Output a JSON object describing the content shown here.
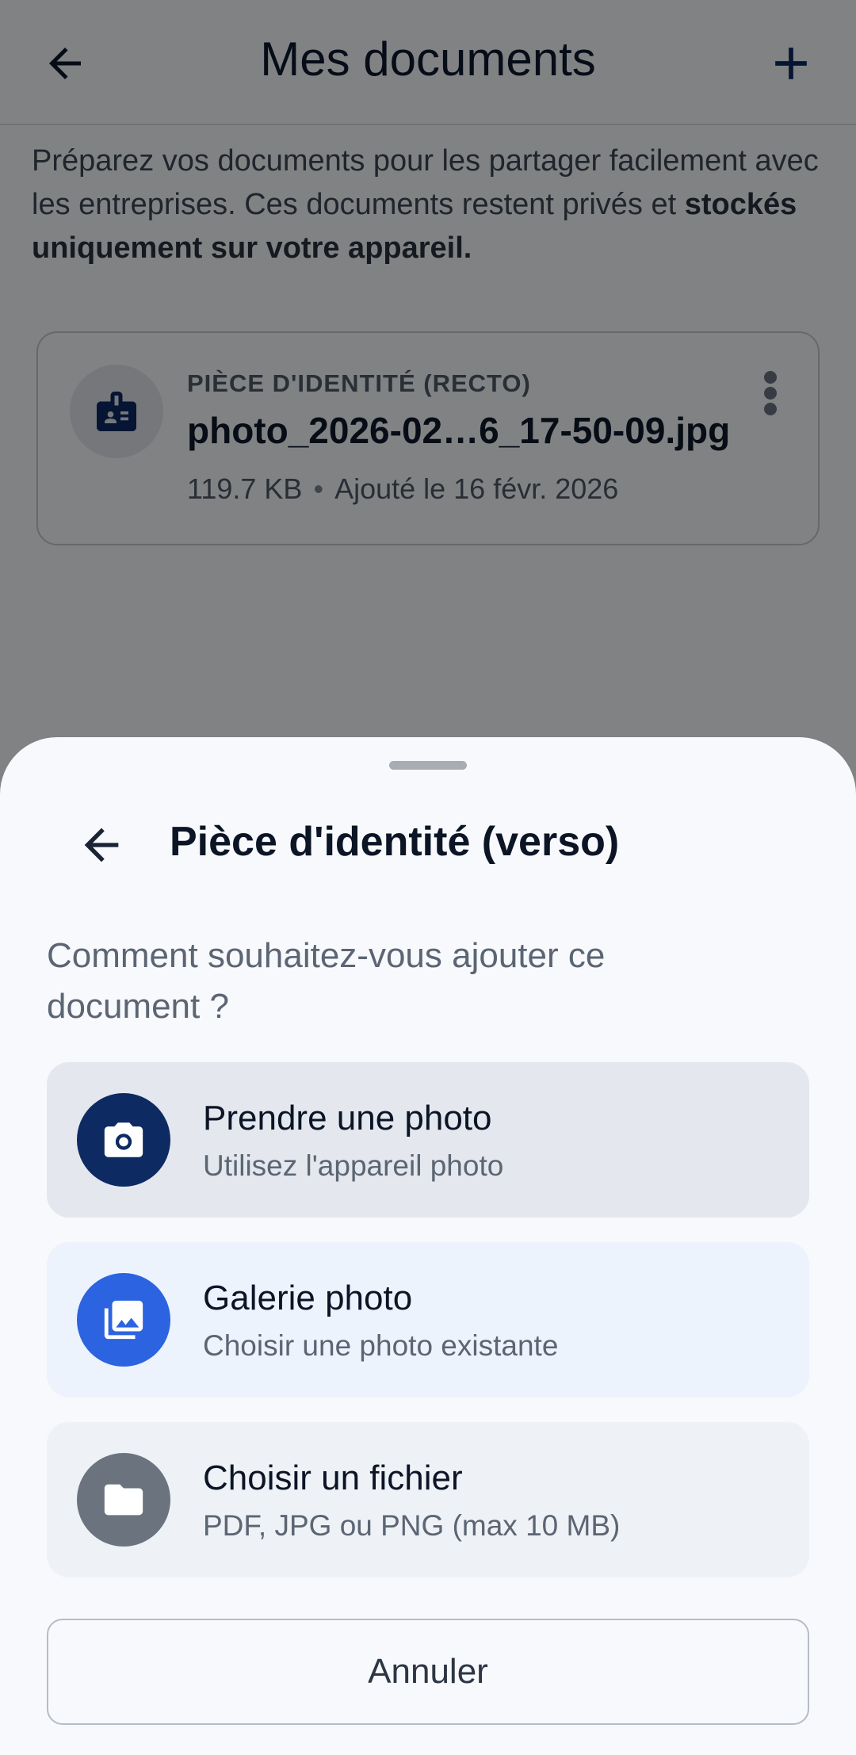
{
  "header": {
    "title": "Mes documents",
    "back_icon": "arrow-left-icon",
    "add_icon": "plus-icon"
  },
  "intro": {
    "text": "Préparez vos documents pour les partager facilement avec les entreprises. Ces documents restent privés et ",
    "bold": "stockés uniquement sur votre appareil."
  },
  "documents": [
    {
      "type": "PIÈCE D'IDENTITÉ (RECTO)",
      "name": "photo_2026-02…6_17-50-09.jpg",
      "size": "119.7 KB",
      "separator": "•",
      "added": "Ajouté le 16 févr. 2026",
      "icon": "id-badge-icon",
      "menu_icon": "more-vertical-icon"
    }
  ],
  "sheet": {
    "title": "Pièce d'identité (verso)",
    "question": "Comment souhaitez-vous ajouter ce document ?",
    "options": [
      {
        "title": "Prendre une photo",
        "subtitle": "Utilisez l'appareil photo",
        "icon": "camera-icon",
        "color": "#0d2a63"
      },
      {
        "title": "Galerie photo",
        "subtitle": "Choisir une photo existante",
        "icon": "photo-library-icon",
        "color": "#2c63e0"
      },
      {
        "title": "Choisir un fichier",
        "subtitle": "PDF, JPG ou PNG (max 10 MB)",
        "icon": "folder-icon",
        "color": "#6a737e"
      }
    ],
    "cancel_label": "Annuler"
  }
}
